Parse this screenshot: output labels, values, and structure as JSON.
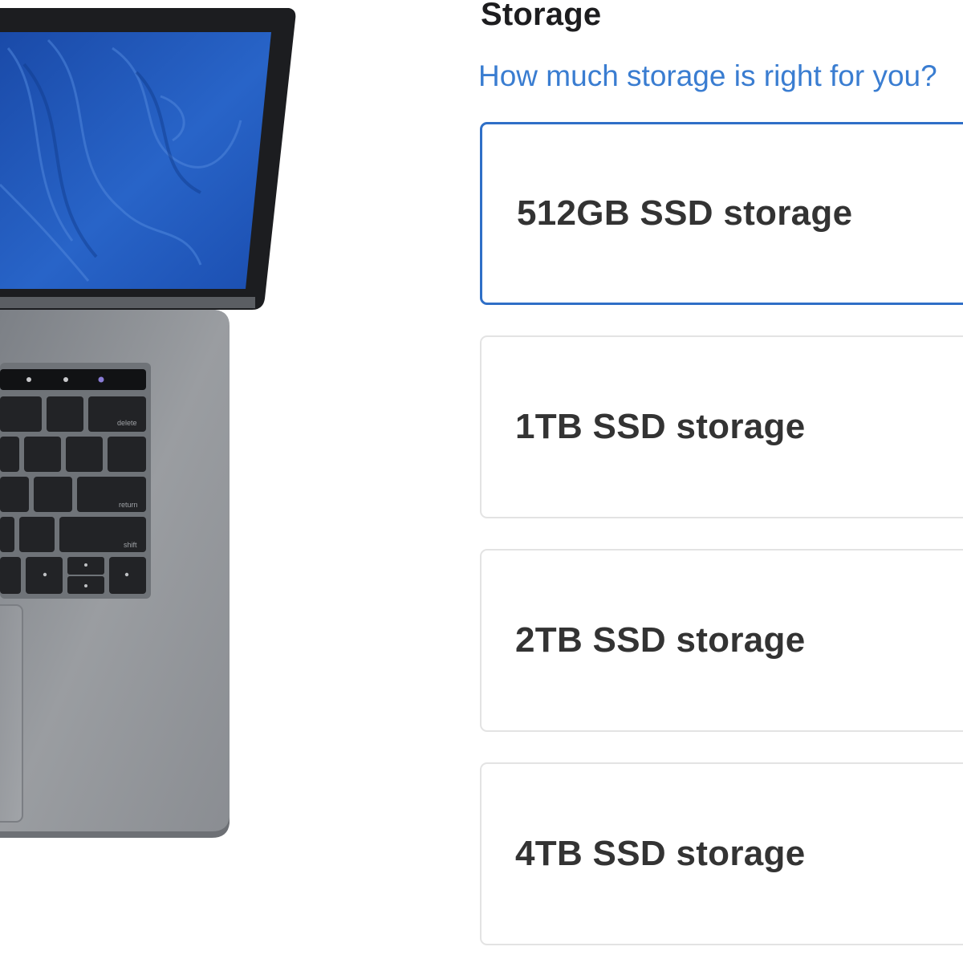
{
  "storage": {
    "title": "Storage",
    "help_link": "How much storage is right for you?",
    "selected_index": 0,
    "options": [
      {
        "label": "512GB SSD storage"
      },
      {
        "label": "1TB SSD storage"
      },
      {
        "label": "2TB SSD storage"
      },
      {
        "label": "4TB SSD storage"
      }
    ]
  },
  "product_image": {
    "icon": "laptop-image",
    "keyboard_key_labels": [
      "delete",
      "return",
      "shift"
    ]
  },
  "colors": {
    "accent": "#2f6fc7",
    "link": "#3a7dd1",
    "title": "#1d1d1f",
    "option_text": "#333333",
    "option_border": "#e3e3e3",
    "laptop_body": "#8f9296",
    "screen_blue": "#1f56b8"
  }
}
